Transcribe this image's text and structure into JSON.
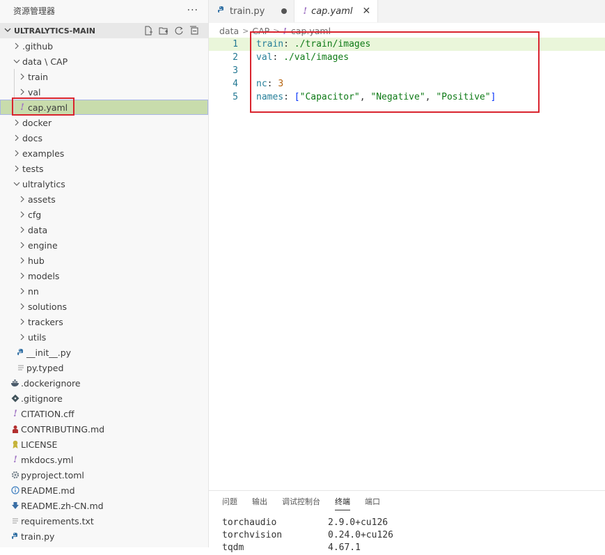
{
  "sidebar": {
    "title": "资源管理器",
    "more": "···",
    "root": "ULTRALYTICS-MAIN",
    "items": [
      {
        "label": ".github",
        "icon": "chevron-right-icon"
      },
      {
        "label": "data \\ CAP",
        "icon": "chevron-down-icon"
      },
      {
        "label": "train",
        "icon": "chevron-right-icon"
      },
      {
        "label": "val",
        "icon": "chevron-right-icon"
      },
      {
        "label": "cap.yaml",
        "icon": "yaml-icon"
      },
      {
        "label": "docker",
        "icon": "chevron-right-icon"
      },
      {
        "label": "docs",
        "icon": "chevron-right-icon"
      },
      {
        "label": "examples",
        "icon": "chevron-right-icon"
      },
      {
        "label": "tests",
        "icon": "chevron-right-icon"
      },
      {
        "label": "ultralytics",
        "icon": "chevron-down-icon"
      },
      {
        "label": "assets",
        "icon": "chevron-right-icon"
      },
      {
        "label": "cfg",
        "icon": "chevron-right-icon"
      },
      {
        "label": "data",
        "icon": "chevron-right-icon"
      },
      {
        "label": "engine",
        "icon": "chevron-right-icon"
      },
      {
        "label": "hub",
        "icon": "chevron-right-icon"
      },
      {
        "label": "models",
        "icon": "chevron-right-icon"
      },
      {
        "label": "nn",
        "icon": "chevron-right-icon"
      },
      {
        "label": "solutions",
        "icon": "chevron-right-icon"
      },
      {
        "label": "trackers",
        "icon": "chevron-right-icon"
      },
      {
        "label": "utils",
        "icon": "chevron-right-icon"
      },
      {
        "label": "__init__.py",
        "icon": "python-icon"
      },
      {
        "label": "py.typed",
        "icon": "text-file-icon"
      },
      {
        "label": ".dockerignore",
        "icon": "docker-icon"
      },
      {
        "label": ".gitignore",
        "icon": "git-icon"
      },
      {
        "label": "CITATION.cff",
        "icon": "yaml-icon"
      },
      {
        "label": "CONTRIBUTING.md",
        "icon": "contributing-icon"
      },
      {
        "label": "LICENSE",
        "icon": "license-icon"
      },
      {
        "label": "mkdocs.yml",
        "icon": "yaml-icon"
      },
      {
        "label": "pyproject.toml",
        "icon": "gear-icon"
      },
      {
        "label": "README.md",
        "icon": "info-icon"
      },
      {
        "label": "README.zh-CN.md",
        "icon": "download-icon"
      },
      {
        "label": "requirements.txt",
        "icon": "text-file-icon"
      },
      {
        "label": "train.py",
        "icon": "python-icon"
      }
    ]
  },
  "tabs": [
    {
      "label": "train.py",
      "icon": "python-icon",
      "state": "modified"
    },
    {
      "label": "cap.yaml",
      "icon": "yaml-icon",
      "state": "active"
    }
  ],
  "breadcrumb": [
    "data",
    "CAP",
    "cap.yaml"
  ],
  "editor": {
    "line_numbers": [
      "1",
      "2",
      "3",
      "4",
      "5"
    ],
    "line1": {
      "key": "train",
      "value": "./train/images"
    },
    "line2": {
      "key": "val",
      "value": "./val/images"
    },
    "line4": {
      "key": "nc",
      "value": "3"
    },
    "line5": {
      "key": "names",
      "values": [
        "\"Capacitor\"",
        "\"Negative\"",
        "\"Positive\""
      ]
    }
  },
  "panel": {
    "tabs": [
      "问题",
      "输出",
      "调试控制台",
      "终端",
      "端口"
    ],
    "active_tab": "终端",
    "terminal": [
      {
        "pkg": "torchaudio",
        "ver": "2.9.0+cu126"
      },
      {
        "pkg": "torchvision",
        "ver": "0.24.0+cu126"
      },
      {
        "pkg": "tqdm",
        "ver": "4.67.1"
      }
    ]
  },
  "colors": {
    "selection": "#c8dcac",
    "highlight_box": "#d9242e",
    "python": "#3572a5",
    "yaml": "#a074c4"
  }
}
